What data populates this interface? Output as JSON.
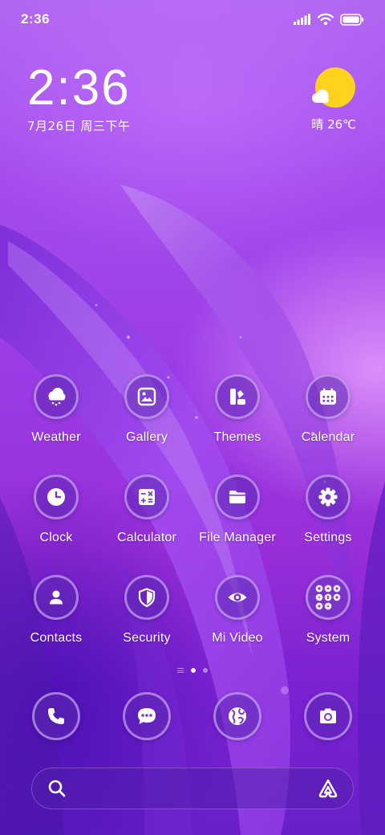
{
  "status_bar": {
    "time": "2:36",
    "icons": [
      "signal-icon",
      "wifi-icon",
      "battery-icon"
    ]
  },
  "clock_widget": {
    "time": "2:36",
    "date": "7月26日 周三下午"
  },
  "weather_widget": {
    "text": "晴 26℃",
    "icon": "sunny-cloud-icon"
  },
  "apps": [
    [
      {
        "label": "Weather",
        "icon": "weather-cloud-icon"
      },
      {
        "label": "Gallery",
        "icon": "gallery-icon"
      },
      {
        "label": "Themes",
        "icon": "themes-icon"
      },
      {
        "label": "Calendar",
        "icon": "calendar-icon"
      }
    ],
    [
      {
        "label": "Clock",
        "icon": "clock-icon"
      },
      {
        "label": "Calculator",
        "icon": "calculator-icon"
      },
      {
        "label": "File Manager",
        "icon": "folder-icon"
      },
      {
        "label": "Settings",
        "icon": "gear-icon"
      }
    ],
    [
      {
        "label": "Contacts",
        "icon": "person-icon"
      },
      {
        "label": "Security",
        "icon": "shield-icon"
      },
      {
        "label": "Mi Video",
        "icon": "eye-icon"
      },
      {
        "label": "System",
        "icon": "folder-grid-icon"
      }
    ]
  ],
  "page_indicator": {
    "pages": 3,
    "active_page": 2
  },
  "dock": [
    {
      "icon": "phone-icon"
    },
    {
      "icon": "messages-icon"
    },
    {
      "icon": "browser-globe-icon"
    },
    {
      "icon": "camera-icon"
    }
  ],
  "search": {
    "value": "",
    "placeholder": "",
    "icon": "search-icon",
    "assistant_icon": "assistant-icon"
  },
  "colors": {
    "wallpaper_primary": "#9a3ce6",
    "wallpaper_deep": "#6a1fc9",
    "wallpaper_light": "#c58cf6",
    "sun": "#ffd21f",
    "text": "#ffffff"
  }
}
